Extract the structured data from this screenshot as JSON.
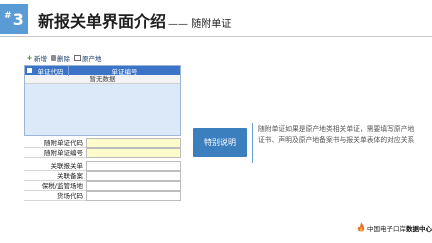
{
  "header": {
    "slide_number": "3",
    "hash": "#",
    "title": "新报关单界面介绍",
    "subtitle": "—— 随附单证"
  },
  "toolbar": {
    "add_label": "新增",
    "delete_label": "删除",
    "origin_label": "原产地"
  },
  "grid": {
    "col1_header": "单证代码",
    "col2_header": "单证编号",
    "empty_text": "暂无数据"
  },
  "fields": [
    {
      "label": "随附单证代码",
      "value": "",
      "highlight": true
    },
    {
      "label": "随附单证编号",
      "value": "",
      "highlight": true
    },
    {
      "label": "关联报关单",
      "value": "",
      "highlight": false
    },
    {
      "label": "关联备案",
      "value": "",
      "highlight": false
    },
    {
      "label": "保税/监管场地",
      "value": "",
      "highlight": false
    },
    {
      "label": "货场代码",
      "value": "",
      "highlight": false
    }
  ],
  "callout": {
    "button_label": "特别说明",
    "text": "随附单证如果是原产地类相关单证，需要填写原产地证书、声明及原产地备案书与报关单表体的对应关系"
  },
  "footer": {
    "prefix": "中国电子口岸",
    "highlight": "数据中心"
  },
  "colors": {
    "accent": "#5b9bd5",
    "grid_header": "#3b73c7",
    "callout": "#3c7fbf",
    "required_field": "#fbfbcc"
  }
}
